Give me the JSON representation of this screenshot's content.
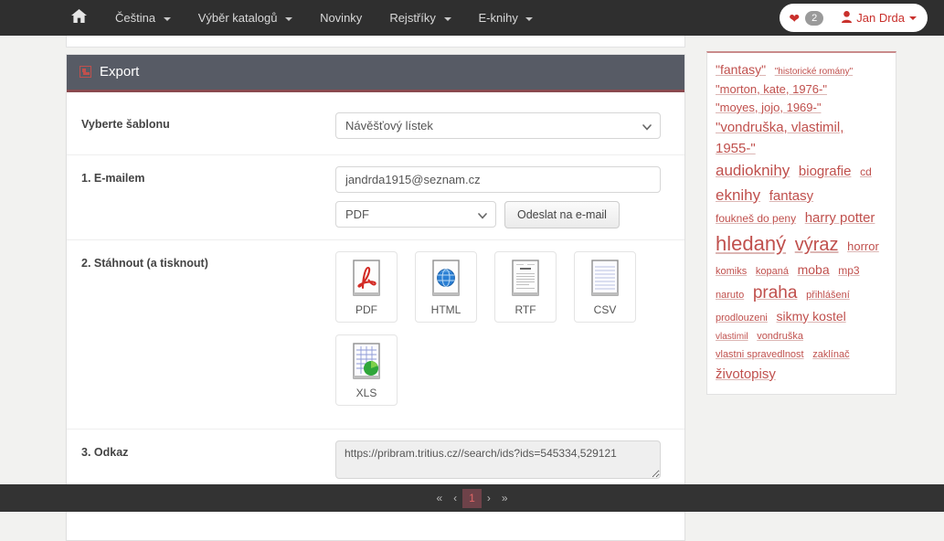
{
  "navbar": {
    "home_icon": "home-icon",
    "items": [
      {
        "label": "Čeština",
        "caret": true
      },
      {
        "label": "Výběr katalogů",
        "caret": true
      },
      {
        "label": "Novinky",
        "caret": false
      },
      {
        "label": "Rejstříky",
        "caret": true
      },
      {
        "label": "E-knihy",
        "caret": true
      }
    ],
    "favorites": {
      "icon": "heart-icon",
      "count": "2"
    },
    "user": {
      "icon": "user-icon",
      "name": "Jan Drda"
    }
  },
  "panel": {
    "title": "Export",
    "title_icon": "broken-image-icon"
  },
  "form": {
    "template": {
      "label": "Vyberte šablonu",
      "value": "Návěšťový lístek",
      "options": [
        "Návěšťový lístek"
      ]
    },
    "email": {
      "label": "1. E-mailem",
      "value": "jandrda1915@seznam.cz",
      "placeholder": "",
      "format": {
        "value": "PDF",
        "options": [
          "PDF",
          "HTML",
          "RTF",
          "CSV",
          "XLS"
        ]
      },
      "send_button": "Odeslat na e-mail"
    },
    "download": {
      "label": "2. Stáhnout (a tisknout)",
      "tiles": [
        {
          "label": "PDF",
          "icon": "pdf-file-icon"
        },
        {
          "label": "HTML",
          "icon": "html-globe-file-icon"
        },
        {
          "label": "RTF",
          "icon": "rtf-document-icon"
        },
        {
          "label": "CSV",
          "icon": "csv-lined-file-icon"
        },
        {
          "label": "XLS",
          "icon": "xls-spreadsheet-chart-icon"
        }
      ]
    },
    "link": {
      "label": "3. Odkaz",
      "value": "https://pribram.tritius.cz//search/ids?ids=545334,529121",
      "link_text": "Odkaz"
    }
  },
  "tagcloud": {
    "tags": [
      {
        "text": "\"fantasy\"",
        "size": 14
      },
      {
        "text": "\"historické romány\"",
        "size": 10
      },
      {
        "text": "\"morton, kate, 1976-\"",
        "size": 13
      },
      {
        "text": "\"moyes, jojo, 1969-\"",
        "size": 13
      },
      {
        "text": "\"vondruška, vlastimil, 1955-\"",
        "size": 15
      },
      {
        "text": "audioknihy",
        "size": 17
      },
      {
        "text": "biografie",
        "size": 15
      },
      {
        "text": "cd",
        "size": 12
      },
      {
        "text": "eknihy",
        "size": 17
      },
      {
        "text": "fantasy",
        "size": 15
      },
      {
        "text": "foukneš do peny",
        "size": 12
      },
      {
        "text": "harry potter",
        "size": 15
      },
      {
        "text": "hledaný",
        "size": 22
      },
      {
        "text": "výraz",
        "size": 20
      },
      {
        "text": "horror",
        "size": 13
      },
      {
        "text": "komiks",
        "size": 11
      },
      {
        "text": "kopaná",
        "size": 11
      },
      {
        "text": "moba",
        "size": 14
      },
      {
        "text": "mp3",
        "size": 12
      },
      {
        "text": "naruto",
        "size": 11
      },
      {
        "text": "praha",
        "size": 19
      },
      {
        "text": "přihlášení",
        "size": 11
      },
      {
        "text": "prodlouzeni",
        "size": 11
      },
      {
        "text": "sikmy kostel",
        "size": 14
      },
      {
        "text": "vlastimil",
        "size": 10
      },
      {
        "text": "vondruška",
        "size": 11
      },
      {
        "text": "vlastni spravedlnost",
        "size": 11
      },
      {
        "text": "zaklínač",
        "size": 11
      },
      {
        "text": "životopisy",
        "size": 15
      }
    ]
  },
  "pagination": {
    "first": "«",
    "prev": "‹",
    "pages": [
      "1"
    ],
    "active": "1",
    "next": "›",
    "last": "»"
  }
}
